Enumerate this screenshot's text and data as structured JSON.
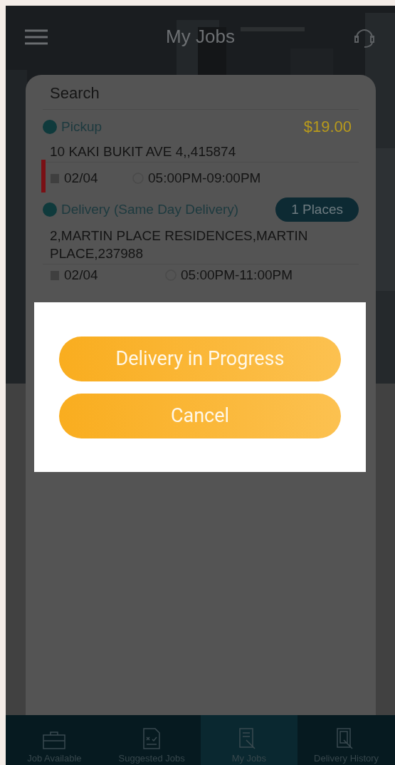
{
  "header": {
    "title": "My Jobs"
  },
  "search": {
    "placeholder": "Search"
  },
  "job": {
    "pickup": {
      "label": "Pickup",
      "price": "$19.00",
      "address": "10 KAKI BUKIT AVE 4,,415874",
      "date": "02/04",
      "time": "05:00PM-09:00PM"
    },
    "delivery": {
      "label": "Delivery (Same Day Delivery)",
      "places": "1 Places",
      "address": "2,MARTIN PLACE RESIDENCES,MARTIN PLACE,237988",
      "date": "02/04",
      "time": "05:00PM-11:00PM"
    }
  },
  "dialog": {
    "buttons": [
      "Delivery in Progress",
      "Cancel"
    ]
  },
  "nav": [
    {
      "label": "Job Available",
      "selected": false
    },
    {
      "label": "Suggested Jobs",
      "selected": false
    },
    {
      "label": "My Jobs",
      "selected": true
    },
    {
      "label": "Delivery History",
      "selected": false
    }
  ]
}
